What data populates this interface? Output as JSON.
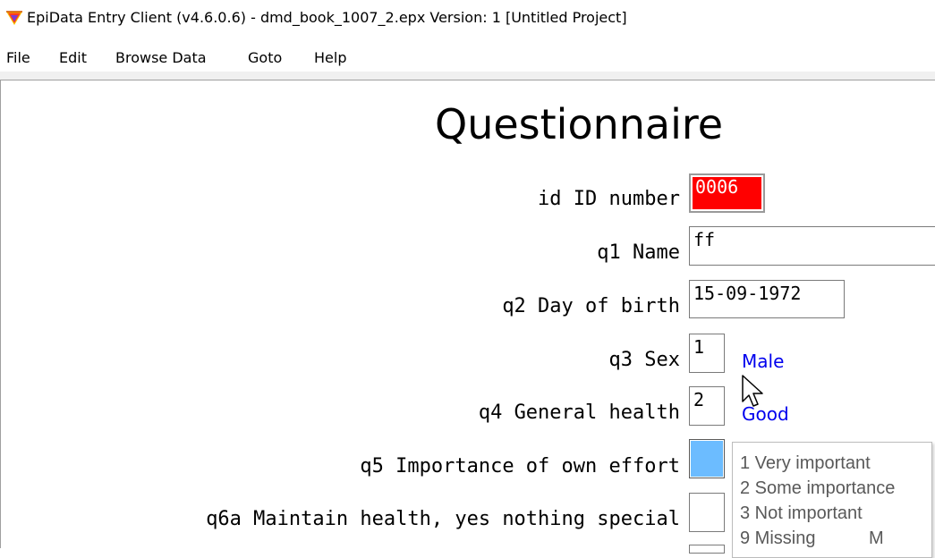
{
  "window": {
    "title": "EpiData Entry Client (v4.6.0.6) - dmd_book_1007_2.epx Version: 1 [Untitled Project]",
    "icon": "epidata-app-icon"
  },
  "menu": {
    "file": "File",
    "edit": "Edit",
    "browse": "Browse Data",
    "goto": "Goto",
    "help": "Help"
  },
  "form": {
    "heading": "Questionnaire",
    "fields": {
      "id": {
        "label": "id ID number",
        "value": "0006"
      },
      "q1": {
        "label": "q1 Name",
        "value": "ff"
      },
      "q2": {
        "label": "q2 Day of birth",
        "value": "15-09-1972"
      },
      "q3": {
        "label": "q3 Sex",
        "value": "1",
        "value_label": "Male"
      },
      "q4": {
        "label": "q4 General health",
        "value": "2",
        "value_label": "Good"
      },
      "q5": {
        "label": "q5 Importance of own effort",
        "value": ""
      },
      "q6a": {
        "label": "q6a Maintain health, yes nothing special",
        "value": ""
      }
    }
  },
  "popup": {
    "items": [
      "1 Very important",
      "2 Some importance",
      "3 Not important",
      "9 Missing"
    ],
    "missing_key": "M"
  },
  "colors": {
    "active_field": "#ff0000",
    "focused_field": "#6cbcff",
    "value_label": "#0000ee"
  }
}
